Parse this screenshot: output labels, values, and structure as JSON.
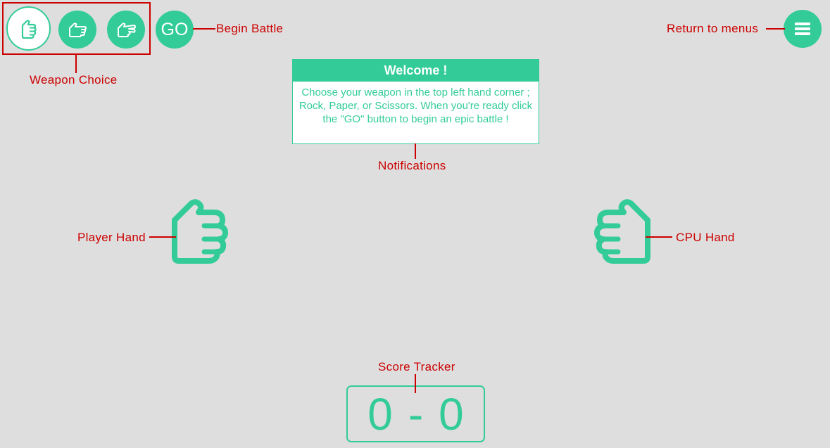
{
  "weapons": {
    "rock": {
      "icon": "fist-icon"
    },
    "paper": {
      "icon": "open-hand-icon"
    },
    "scissors": {
      "icon": "scissors-hand-icon"
    }
  },
  "go_button": {
    "label": "GO"
  },
  "menu_button": {
    "icon": "hamburger-menu-icon"
  },
  "notification": {
    "title": "Welcome !",
    "body": "Choose your weapon in the top left hand corner ; Rock, Paper, or Scissors. When you're ready click the \"GO\" button to begin an epic battle !"
  },
  "hands": {
    "player": {
      "icon": "fist-icon"
    },
    "cpu": {
      "icon": "fist-icon"
    }
  },
  "score": {
    "player": "0",
    "separator": "-",
    "cpu": "0"
  },
  "annotations": {
    "weapon_choice": "Weapon Choice",
    "begin_battle": "Begin Battle",
    "return_to_menus": "Return to menus",
    "notifications": "Notifications",
    "player_hand": "Player Hand",
    "cpu_hand": "CPU Hand",
    "score_tracker": "Score Tracker"
  },
  "colors": {
    "accent": "#33cc99",
    "annotation": "#cc0000",
    "background": "#dedede"
  }
}
